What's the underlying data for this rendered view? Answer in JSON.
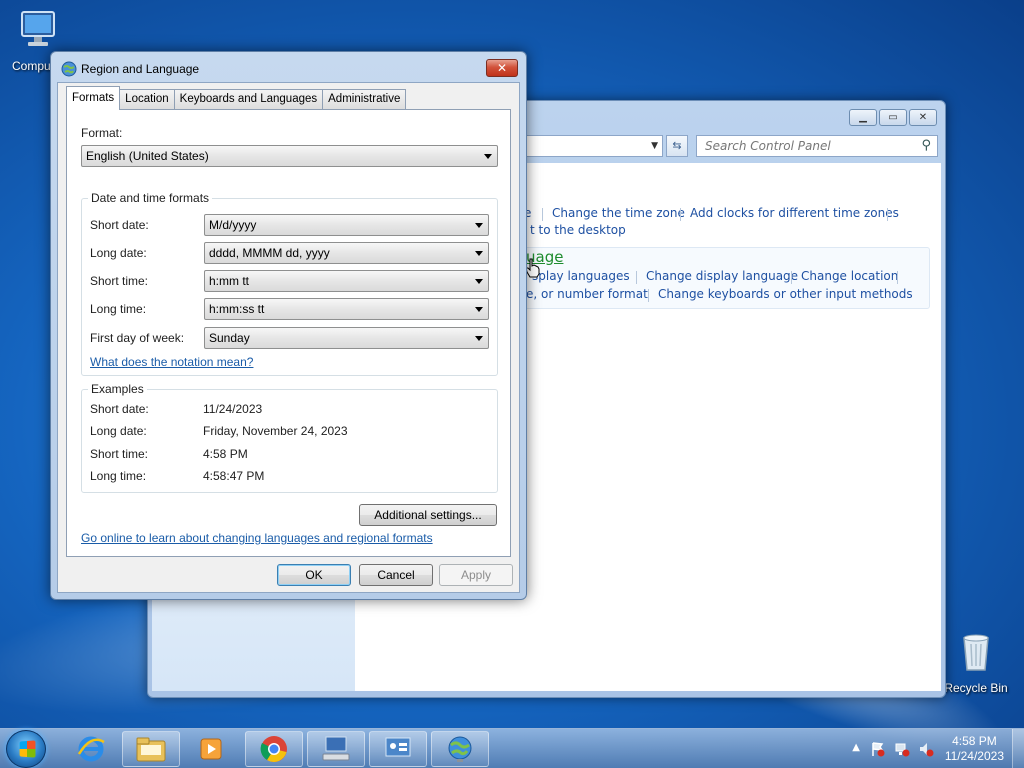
{
  "desktop": {
    "computer_label": "Compu",
    "recycle_label": "Recycle Bin"
  },
  "control_panel": {
    "search_placeholder": "Search Control Panel",
    "links": {
      "e_fragment": "e",
      "change_time_zone": "Change the time zone",
      "add_clocks": "Add clocks for different time zones",
      "to_desktop": "t to the desktop",
      "region_heading_fragment": "uage",
      "display_languages": "splay languages",
      "change_display_language": "Change display language",
      "change_location": "Change location",
      "number_format": "e, or number format",
      "change_keyboards": "Change keyboards or other input methods"
    }
  },
  "dialog": {
    "title": "Region and Language",
    "close_label": "✕",
    "tabs": [
      "Formats",
      "Location",
      "Keyboards and Languages",
      "Administrative"
    ],
    "format_label": "Format:",
    "format_value": "English (United States)",
    "date_time_group": "Date and time formats",
    "fields": [
      {
        "label": "Short date:",
        "value": "M/d/yyyy"
      },
      {
        "label": "Long date:",
        "value": "dddd, MMMM dd, yyyy"
      },
      {
        "label": "Short time:",
        "value": "h:mm tt"
      },
      {
        "label": "Long time:",
        "value": "h:mm:ss tt"
      },
      {
        "label": "First day of week:",
        "value": "Sunday"
      }
    ],
    "notation_link": "What does the notation mean?",
    "examples_group": "Examples",
    "examples": [
      {
        "label": "Short date:",
        "value": "11/24/2023"
      },
      {
        "label": "Long date:",
        "value": "Friday, November 24, 2023"
      },
      {
        "label": "Short time:",
        "value": "4:58 PM"
      },
      {
        "label": "Long time:",
        "value": "4:58:47 PM"
      }
    ],
    "additional_settings": "Additional settings...",
    "online_link": "Go online to learn about changing languages and regional formats",
    "ok": "OK",
    "cancel": "Cancel",
    "apply": "Apply"
  },
  "taskbar": {
    "time": "4:58 PM",
    "date": "11/24/2023"
  }
}
